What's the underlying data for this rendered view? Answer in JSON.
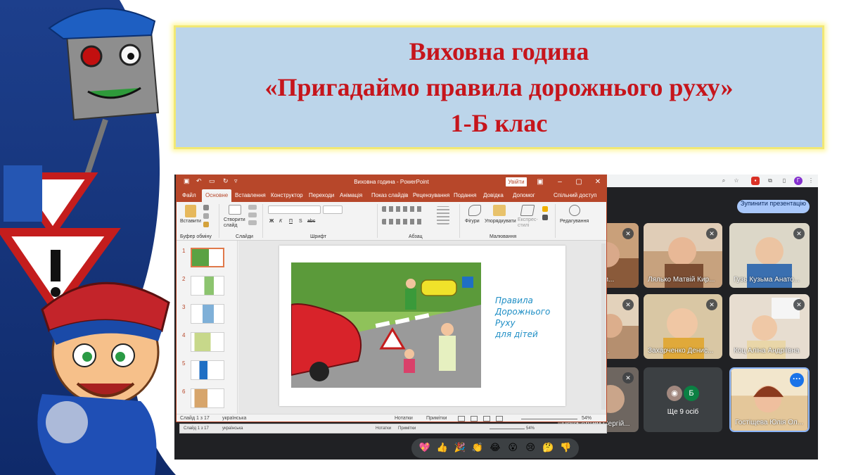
{
  "banner": {
    "line1": "Виховна година",
    "line2": "«Пригадаймо правила дорожнього руху»",
    "line3": "1-Б клас"
  },
  "ppt": {
    "window_title": "Виховна година - PowerPoint",
    "signin_label": "Увійти",
    "tabs": [
      "Файл",
      "Основне",
      "Вставлення",
      "Конструктор",
      "Переходи",
      "Анімація",
      "Показ слайдів",
      "Рецензування",
      "Подання",
      "Довідка",
      "Допомог",
      "Спільний доступ"
    ],
    "ribbon": {
      "paste": "Вставити",
      "clipboard_group": "Буфер обміну",
      "new_slide": "Створити слайд",
      "slides_group": "Слайди",
      "font_group": "Шрифт",
      "paragraph_group": "Абзац",
      "shapes": "Фігури",
      "arrange": "Упорядкувати",
      "quick_styles": "Експрес-стилі",
      "drawing_group": "Малювання",
      "editing": "Редагування",
      "font_buttons": [
        "Ж",
        "К",
        "П",
        "S",
        "abc"
      ]
    },
    "thumb_numbers": [
      "1",
      "2",
      "3",
      "4",
      "5",
      "6"
    ],
    "slide_text": [
      "Правила",
      "Дорожнього",
      "Руху",
      "для дітей"
    ],
    "status": {
      "slide_info": "Слайд 1 з 17",
      "language": "українська",
      "notes": "Нотатки",
      "comments": "Примітки",
      "zoom": "54%"
    }
  },
  "meet": {
    "stop_button": "Зупинити презентацію",
    "participants": [
      {
        "name": "...а Дми..."
      },
      {
        "name": "Лялько Матвій Кир..."
      },
      {
        "name": "Гузь Кузьма Анато..."
      },
      {
        "name": "...ра А..."
      },
      {
        "name": "Захарченко Денис..."
      },
      {
        "name": "Коц Аліна Андріївна"
      },
      {
        "name": "Цопа Артем Сергій..."
      },
      {
        "name": "Гостіщева Юлія Ол..."
      }
    ],
    "more_label": "Ще 9 осіб",
    "more_avatar_letter": "Б",
    "reactions": [
      "💖",
      "👍",
      "🎉",
      "👏",
      "😂",
      "😮",
      "😢",
      "🤔",
      "👎"
    ]
  },
  "colors": {
    "banner_text": "#c6151c",
    "banner_bg": "#bcd5ea",
    "ppt_accent": "#b7472a",
    "meet_bg": "#202124"
  }
}
